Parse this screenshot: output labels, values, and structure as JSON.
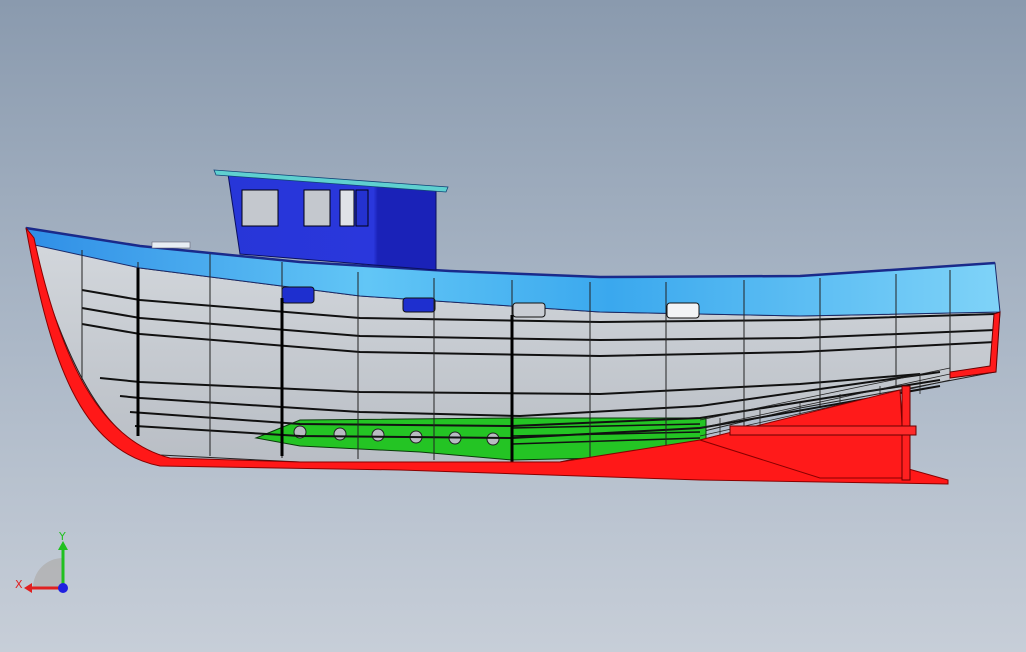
{
  "viewport": {
    "background_top": "#8a9aae",
    "background_bottom": "#c7ced8"
  },
  "model": {
    "colors": {
      "keel_skeg": "#ff1a1a",
      "bulwark": "#46b8f0",
      "hull_plating": "#c8ccd2",
      "cabin": "#1f2fd6",
      "cabin_roof": "#4fc9c9",
      "tank": "#2ec42e",
      "frame_line": "#111111"
    }
  },
  "triad": {
    "x_label": "X",
    "y_label": "Y",
    "x_color": "#e02020",
    "y_color": "#20c020",
    "z_color": "#2020e0"
  }
}
